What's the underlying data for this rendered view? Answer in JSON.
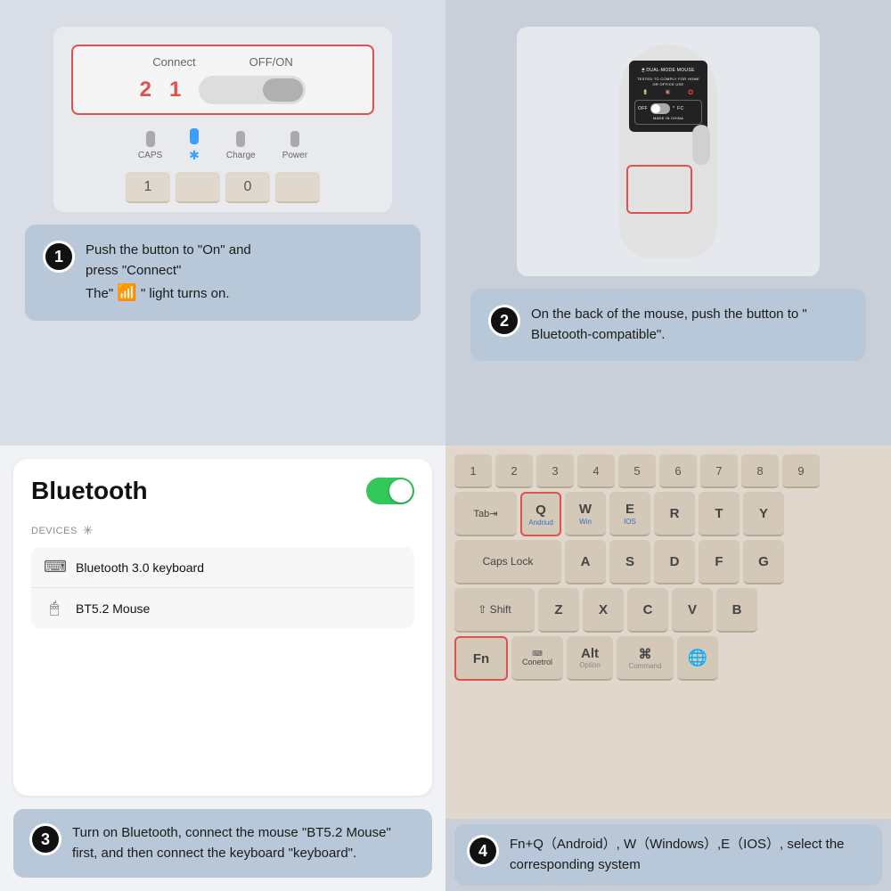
{
  "cells": {
    "cell1": {
      "connect_label": "Connect",
      "offon_label": "OFF/ON",
      "num2": "2",
      "num1": "1",
      "caps_label": "CAPS",
      "charge_label": "Charge",
      "power_label": "Power"
    },
    "cell2": {
      "dual_mode": "DUAL-MODE MOUSE",
      "tested": "TESTED TO COMPLY FOR HOME OR OFFICE USE",
      "made_in": "MADE IN CHINA"
    },
    "step1": {
      "number": "1",
      "line1": "Push the button to \"On\" and",
      "line2": "press \"Connect\"",
      "line3": "The\"",
      "line4": "\" light turns on."
    },
    "step2": {
      "number": "2",
      "text": "On the back of the mouse, push the button to \" Bluetooth-compatible\"."
    },
    "bluetooth": {
      "title": "Bluetooth",
      "toggle_state": "on",
      "devices_header": "DEVICES",
      "device1_name": "Bluetooth 3.0 keyboard",
      "device2_name": "BT5.2 Mouse"
    },
    "step3": {
      "number": "3",
      "text": "Turn on Bluetooth, connect the mouse \"BT5.2 Mouse\" first, and then connect the keyboard \"keyboard\"."
    },
    "keyboard": {
      "keys_row0": [
        "1",
        "2",
        "3",
        "4",
        "5",
        "6"
      ],
      "tab_key": "Tab",
      "q_key": "Q",
      "q_sub": "Andriud",
      "w_key": "W",
      "w_sub": "Win",
      "e_key": "E",
      "e_sub": "IOS",
      "r_key": "R",
      "t_key": "T",
      "y_key": "Y",
      "capslock_key": "Caps Lock",
      "a_key": "A",
      "s_key": "S",
      "d_key": "D",
      "f_key": "F",
      "g_key": "G",
      "shift_key": "⇧ Shift",
      "z_key": "Z",
      "x_key": "X",
      "c_key": "C",
      "v_key": "V",
      "b_key": "B",
      "fn_key": "Fn",
      "ctrl_key": "Conetrol",
      "alt_key": "Alt",
      "cmd_key": "⌘",
      "cmd_sub": "Command",
      "globe_key": "🌐",
      "option_key": "Option"
    },
    "step4": {
      "number": "4",
      "text": "Fn+Q（Android）, W（Windows）,E（IOS）, select the corresponding system"
    }
  }
}
